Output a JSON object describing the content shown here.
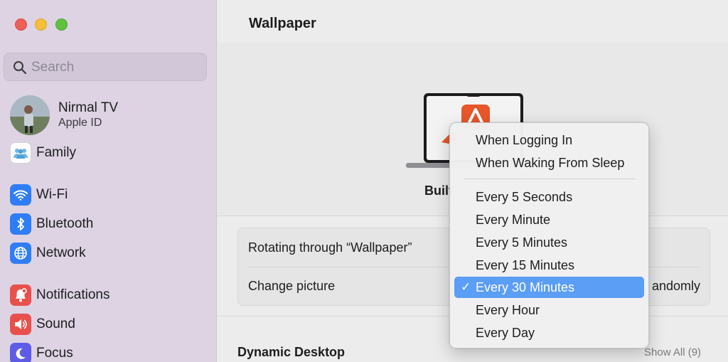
{
  "window": {
    "title": "Wallpaper"
  },
  "search": {
    "placeholder": "Search"
  },
  "account": {
    "name": "Nirmal TV",
    "subtitle": "Apple ID"
  },
  "sidebar": {
    "items": [
      {
        "label": "Family",
        "icon": "family-icon",
        "color": "#6fb6ea"
      },
      {
        "label": "Wi-Fi",
        "icon": "wifi-icon",
        "color": "#2f7df6"
      },
      {
        "label": "Bluetooth",
        "icon": "bluetooth-icon",
        "color": "#2f7df6"
      },
      {
        "label": "Network",
        "icon": "globe-icon",
        "color": "#2f7df6"
      },
      {
        "label": "Notifications",
        "icon": "bell-icon",
        "color": "#e9504b"
      },
      {
        "label": "Sound",
        "icon": "speaker-icon",
        "color": "#e9504b"
      },
      {
        "label": "Focus",
        "icon": "moon-icon",
        "color": "#5e5ce6"
      }
    ]
  },
  "hero": {
    "label": "Built"
  },
  "settings": {
    "rotating_label": "Rotating through “Wallpaper”",
    "change_label": "Change picture",
    "change_value_visible": "andomly"
  },
  "dynamic": {
    "title": "Dynamic Desktop",
    "show_all": "Show All (9)"
  },
  "menu": {
    "items": [
      {
        "label": "When Logging In"
      },
      {
        "label": "When Waking From Sleep"
      },
      {
        "label": "Every 5 Seconds"
      },
      {
        "label": "Every Minute"
      },
      {
        "label": "Every 5 Minutes"
      },
      {
        "label": "Every 15 Minutes"
      },
      {
        "label": "Every 30 Minutes",
        "selected": true
      },
      {
        "label": "Every Hour"
      },
      {
        "label": "Every Day"
      }
    ],
    "checkmark": "✓",
    "accent": "#5b9ef5"
  }
}
